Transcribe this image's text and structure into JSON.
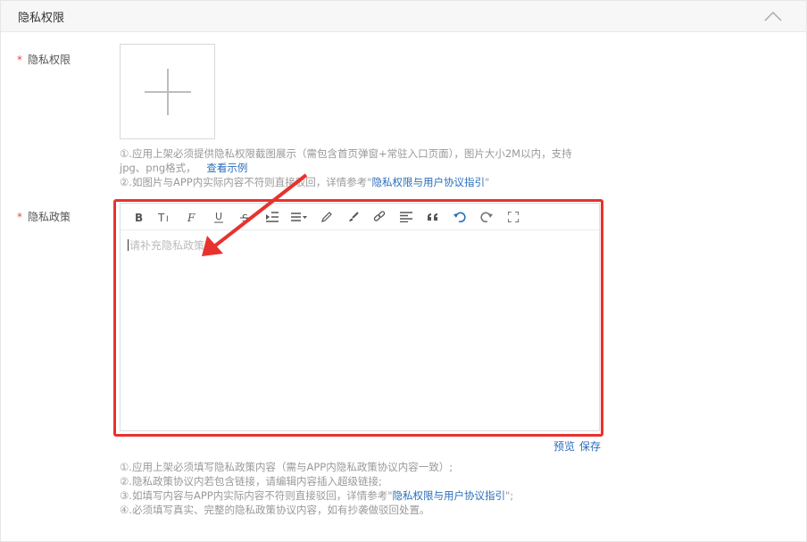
{
  "section": {
    "title": "隐私权限",
    "collapse_icon": "chevron-up-icon"
  },
  "privacy_permission": {
    "required_mark": "*",
    "label": "隐私权限",
    "upload_icon": "plus-icon",
    "hint_line1": "①.应用上架必须提供隐私权限截图展示（需包含首页弹窗+常驻入口页面），图片大小2M以内，支持",
    "hint_line2": "jpg、png格式，",
    "example_link": "查看示例",
    "hint_line3_prefix": "②.如图片与APP内实际内容不符则直接驳回，详情参考\"",
    "guide_link": "隐私权限与用户协议指引",
    "hint_line3_suffix": "\""
  },
  "privacy_policy": {
    "required_mark": "*",
    "label": "隐私政策",
    "placeholder": "请补充隐私政策",
    "toolbar": [
      {
        "name": "bold-icon",
        "glyph": "B"
      },
      {
        "name": "font-size-icon",
        "glyph": "TI"
      },
      {
        "name": "font-family-icon",
        "glyph": "F"
      },
      {
        "name": "underline-icon",
        "glyph": "U"
      },
      {
        "name": "strikethrough-icon",
        "glyph": "S"
      },
      {
        "name": "indent-icon",
        "glyph": ""
      },
      {
        "name": "line-height-icon",
        "glyph": ""
      },
      {
        "name": "pen-icon",
        "glyph": ""
      },
      {
        "name": "brush-icon",
        "glyph": ""
      },
      {
        "name": "link-icon",
        "glyph": ""
      },
      {
        "name": "align-icon",
        "glyph": ""
      },
      {
        "name": "quote-icon",
        "glyph": "❝"
      },
      {
        "name": "undo-icon",
        "glyph": ""
      },
      {
        "name": "redo-icon",
        "glyph": ""
      },
      {
        "name": "fullscreen-icon",
        "glyph": ""
      }
    ],
    "preview_label": "预览",
    "save_label": "保存",
    "hint_line1": "①.应用上架必须填写隐私政策内容（需与APP内隐私政策协议内容一致）;",
    "hint_line2": "②.隐私政策协议内若包含链接，请编辑内容插入超级链接;",
    "hint_line3_prefix": "③.如填写内容与APP内实际内容不符则直接驳回，详情参考\"",
    "guide_link": "隐私权限与用户协议指引",
    "hint_line3_suffix": "\";",
    "hint_line4": "④.必须填写真实、完整的隐私政策协议内容，如有抄袭做驳回处置。"
  },
  "colors": {
    "accent_link": "#2a6ebb",
    "required": "#e84a4a",
    "annotation_red": "#e8322d",
    "toolbar_active": "#2a6ebb"
  }
}
